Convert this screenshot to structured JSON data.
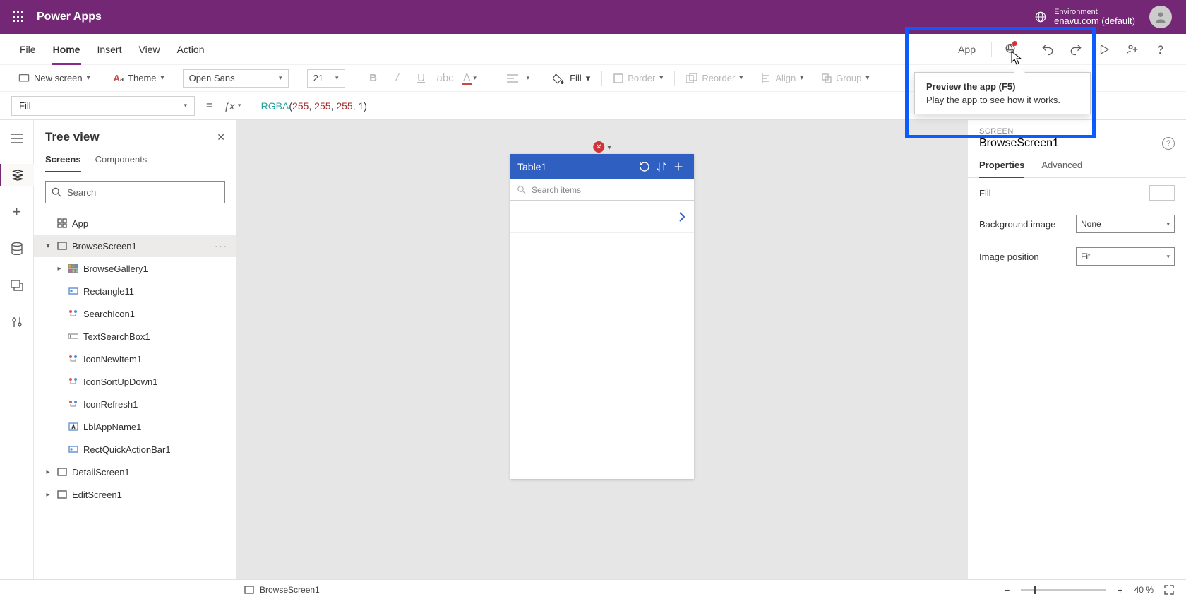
{
  "topbar": {
    "brand": "Power Apps",
    "env_label": "Environment",
    "env_name": "enavu.com (default)"
  },
  "menu": {
    "file": "File",
    "home": "Home",
    "insert": "Insert",
    "view": "View",
    "action": "Action",
    "app": "App"
  },
  "ribbon": {
    "new_screen": "New screen",
    "theme": "Theme",
    "font": "Open Sans",
    "size": "21",
    "fill": "Fill",
    "border": "Border",
    "reorder": "Reorder",
    "align": "Align",
    "group": "Group"
  },
  "fx": {
    "property": "Fill",
    "formula_fn": "RGBA",
    "formula_args": [
      "255",
      "255",
      "255",
      "1"
    ]
  },
  "tree": {
    "title": "Tree view",
    "tab_screens": "Screens",
    "tab_components": "Components",
    "search_ph": "Search",
    "app": "App",
    "browse": "BrowseScreen1",
    "gallery": "BrowseGallery1",
    "rect": "Rectangle11",
    "searchicon": "SearchIcon1",
    "textsearch": "TextSearchBox1",
    "iconnew": "IconNewItem1",
    "iconsort": "IconSortUpDown1",
    "iconrefresh": "IconRefresh1",
    "lblapp": "LblAppName1",
    "rectquick": "RectQuickActionBar1",
    "detail": "DetailScreen1",
    "edit": "EditScreen1"
  },
  "canvas": {
    "table_title": "Table1",
    "search_ph": "Search items"
  },
  "props": {
    "crumb": "SCREEN",
    "title": "BrowseScreen1",
    "tab_props": "Properties",
    "tab_adv": "Advanced",
    "fill": "Fill",
    "bgimg": "Background image",
    "bgimg_val": "None",
    "imgpos": "Image position",
    "imgpos_val": "Fit"
  },
  "status": {
    "screen": "BrowseScreen1",
    "zoom": "40",
    "pct": "%"
  },
  "tooltip": {
    "title": "Preview the app (F5)",
    "body": "Play the app to see how it works."
  }
}
